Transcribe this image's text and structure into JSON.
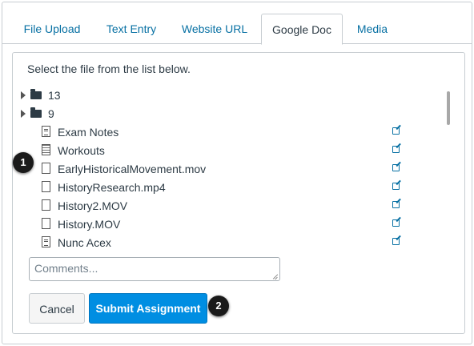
{
  "tabs": [
    {
      "label": "File Upload",
      "active": false
    },
    {
      "label": "Text Entry",
      "active": false
    },
    {
      "label": "Website URL",
      "active": false
    },
    {
      "label": "Google Doc",
      "active": true
    },
    {
      "label": "Media",
      "active": false
    }
  ],
  "panel": {
    "instructions": "Select the file from the list below."
  },
  "file_list": {
    "folders": [
      {
        "name": "13",
        "icon": "folder-icon"
      },
      {
        "name": "9",
        "icon": "folder-icon"
      }
    ],
    "files": [
      {
        "name": "Exam Notes",
        "icon": "document-icon"
      },
      {
        "name": "Workouts",
        "icon": "spreadsheet-icon"
      },
      {
        "name": "EarlyHistoricalMovement.mov",
        "icon": "file-icon"
      },
      {
        "name": "HistoryResearch.mp4",
        "icon": "file-icon"
      },
      {
        "name": "History2.MOV",
        "icon": "file-icon"
      },
      {
        "name": "History.MOV",
        "icon": "file-icon"
      },
      {
        "name": "Nunc Acex",
        "icon": "document-icon"
      }
    ]
  },
  "comments": {
    "placeholder": "Comments..."
  },
  "buttons": {
    "cancel": "Cancel",
    "submit": "Submit Assignment"
  },
  "callouts": [
    "1",
    "2"
  ],
  "colors": {
    "link": "#0770a3",
    "primary_button": "#008ee2",
    "text": "#2d3b45",
    "border": "#c7cdd1"
  }
}
